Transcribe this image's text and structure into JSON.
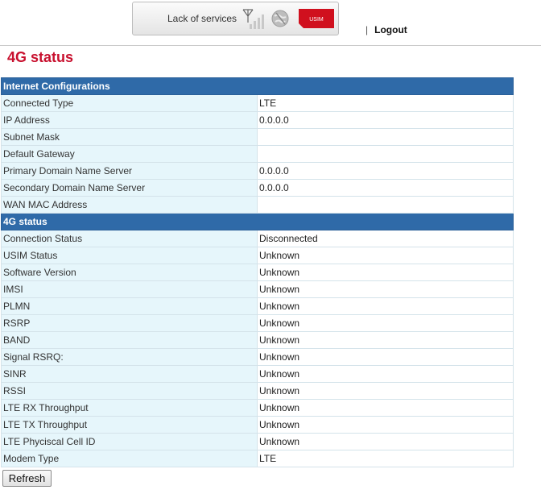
{
  "header": {
    "service_status": "Lack of services",
    "usim_label": "USIM",
    "logout_label": "Logout",
    "separator": "|",
    "usim_color": "#d0101e"
  },
  "page_title": "4G status",
  "accent_colors": {
    "title": "#c8102e",
    "section_header": "#2f6aa8"
  },
  "internet_config": {
    "title": "Internet Configurations",
    "rows": [
      {
        "label": "Connected Type",
        "value": "LTE"
      },
      {
        "label": "IP Address",
        "value": "0.0.0.0"
      },
      {
        "label": "Subnet Mask",
        "value": ""
      },
      {
        "label": "Default Gateway",
        "value": ""
      },
      {
        "label": "Primary Domain Name Server",
        "value": "0.0.0.0"
      },
      {
        "label": "Secondary Domain Name Server",
        "value": "0.0.0.0"
      },
      {
        "label": "WAN MAC Address",
        "value": ""
      }
    ]
  },
  "lte_status": {
    "title": "4G status",
    "rows": [
      {
        "label": "Connection Status",
        "value": "Disconnected"
      },
      {
        "label": "USIM Status",
        "value": "Unknown"
      },
      {
        "label": "Software Version",
        "value": "Unknown"
      },
      {
        "label": "IMSI",
        "value": "Unknown"
      },
      {
        "label": "PLMN",
        "value": "Unknown"
      },
      {
        "label": "RSRP",
        "value": "Unknown"
      },
      {
        "label": "BAND",
        "value": "Unknown"
      },
      {
        "label": "Signal RSRQ:",
        "value": "Unknown"
      },
      {
        "label": "SINR",
        "value": "Unknown"
      },
      {
        "label": "RSSI",
        "value": "Unknown"
      },
      {
        "label": "LTE RX Throughput",
        "value": "Unknown"
      },
      {
        "label": "LTE TX Throughput",
        "value": "Unknown"
      },
      {
        "label": "LTE Phyciscal Cell ID",
        "value": "Unknown"
      },
      {
        "label": "Modem Type",
        "value": "LTE"
      }
    ]
  },
  "refresh_label": "Refresh"
}
